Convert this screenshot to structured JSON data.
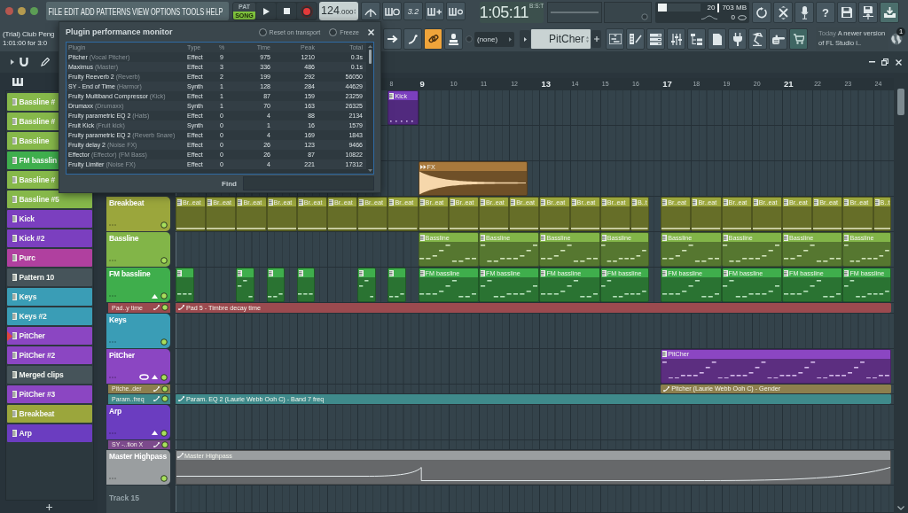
{
  "menu": [
    "FILE",
    "EDIT",
    "ADD",
    "PATTERNS",
    "VIEW",
    "OPTIONS",
    "TOOLS",
    "HELP"
  ],
  "transport": {
    "modes": [
      {
        "label": "PAT",
        "selected": false
      },
      {
        "label": "SONG",
        "selected": true
      }
    ],
    "tempo": "124",
    "tempo_fraction": ".000",
    "countdown_label": "3.2",
    "time": "1:05:11",
    "time_unit": "B:S:T"
  },
  "performance": {
    "cpu": {
      "level": 0.2
    },
    "cpu_reading": "20",
    "memory": "703 MB",
    "polyphony": "0"
  },
  "toolbar": {
    "help": "?"
  },
  "project": {
    "title": "(Trial) Club Peng",
    "length": "1:01:00 for 3:0"
  },
  "tools": [
    {
      "selected": false
    },
    {
      "selected": false
    },
    {
      "selected": true
    },
    {
      "selected": false
    }
  ],
  "dropdown": {
    "value": "(none)"
  },
  "pattern_selector": {
    "value": "PitCher"
  },
  "news": {
    "date": "Today",
    "text": "A newer version of FL Studio i..",
    "badge": "1"
  },
  "performance_monitor": {
    "title": "Plugin performance monitor",
    "options": [
      {
        "label": "Reset on transport",
        "checked": false
      },
      {
        "label": "Freeze",
        "checked": false
      }
    ],
    "columns": [
      "Plugin",
      "Type",
      "%",
      "Time",
      "Peak",
      "Total"
    ],
    "rows": [
      {
        "plugin": "Pitcher",
        "target": "(Vocal Pitcher)",
        "type": "Effect",
        "percent": "9",
        "time": "975",
        "peak": "1210",
        "total": "0.3s"
      },
      {
        "plugin": "Maximus",
        "target": "(Master)",
        "type": "Effect",
        "percent": "3",
        "time": "336",
        "peak": "486",
        "total": "0.1s"
      },
      {
        "plugin": "Fruity Reeverb 2",
        "target": "(Reverb)",
        "type": "Effect",
        "percent": "2",
        "time": "199",
        "peak": "292",
        "total": "56050"
      },
      {
        "plugin": "SY - End of Time",
        "target": "(Harmor)",
        "type": "Synth",
        "percent": "1",
        "time": "128",
        "peak": "284",
        "total": "44629"
      },
      {
        "plugin": "Fruity Multiband Compressor",
        "target": "(Kick)",
        "type": "Effect",
        "percent": "1",
        "time": "87",
        "peak": "159",
        "total": "23259"
      },
      {
        "plugin": "Drumaxx",
        "target": "(Drumaxx)",
        "type": "Synth",
        "percent": "1",
        "time": "70",
        "peak": "163",
        "total": "26325"
      },
      {
        "plugin": "Fruity parametric EQ 2",
        "target": "(Hats)",
        "type": "Effect",
        "percent": "0",
        "time": "4",
        "peak": "88",
        "total": "2134"
      },
      {
        "plugin": "Fruit Kick",
        "target": "(Fruit kick)",
        "type": "Synth",
        "percent": "0",
        "time": "1",
        "peak": "16",
        "total": "1579"
      },
      {
        "plugin": "Fruity parametric EQ 2",
        "target": "(Reverb Snare)",
        "type": "Effect",
        "percent": "0",
        "time": "4",
        "peak": "169",
        "total": "1843"
      },
      {
        "plugin": "Fruity delay 2",
        "target": "(Noise FX)",
        "type": "Effect",
        "percent": "0",
        "time": "26",
        "peak": "123",
        "total": "9466"
      },
      {
        "plugin": "Effector",
        "target": "(Effector) (FM Bass)",
        "type": "Effect",
        "percent": "0",
        "time": "26",
        "peak": "87",
        "total": "10822"
      },
      {
        "plugin": "Fruity Limiter",
        "target": "(Noise FX)",
        "type": "Effect",
        "percent": "0",
        "time": "4",
        "peak": "221",
        "total": "17312"
      }
    ],
    "find_label": "Find"
  },
  "patterns": [
    {
      "name": "Bassline #",
      "color": "#86b84a",
      "selected": false
    },
    {
      "name": "Bassline #",
      "color": "#86b84a",
      "selected": false
    },
    {
      "name": "Bassline",
      "color": "#86b84a",
      "selected": false
    },
    {
      "name": "FM basslin",
      "color": "#3fae4d",
      "selected": false
    },
    {
      "name": "Bassline #",
      "color": "#86b84a",
      "selected": false
    },
    {
      "name": "Bassline #5",
      "color": "#86b84a",
      "selected": false
    },
    {
      "name": "Kick",
      "color": "#7b3fbf",
      "selected": false
    },
    {
      "name": "Kick #2",
      "color": "#7b3fbf",
      "selected": false
    },
    {
      "name": "Purc",
      "color": "#b0409f",
      "selected": false
    },
    {
      "name": "Pattern 10",
      "color": "#46545a",
      "selected": false
    },
    {
      "name": "Keys",
      "color": "#3a9db6",
      "selected": false
    },
    {
      "name": "Keys #2",
      "color": "#3a9db6",
      "selected": false
    },
    {
      "name": "PitCher",
      "color": "#8b46c2",
      "selected": true
    },
    {
      "name": "PitCher #2",
      "color": "#8b46c2",
      "selected": false
    },
    {
      "name": "Merged clips",
      "color": "#46545a",
      "selected": false
    },
    {
      "name": "PitCher #3",
      "color": "#8b46c2",
      "selected": false
    },
    {
      "name": "Breakbeat",
      "color": "#9ba63c",
      "selected": false
    },
    {
      "name": "Arp",
      "color": "#6b3dc0",
      "selected": false
    }
  ],
  "playlist": {
    "ruler": [
      {
        "label": "8",
        "major": false
      },
      {
        "label": "9",
        "major": true
      },
      {
        "label": "10",
        "major": false
      },
      {
        "label": "11",
        "major": false
      },
      {
        "label": "12",
        "major": false
      },
      {
        "label": "13",
        "major": true
      },
      {
        "label": "14",
        "major": false
      },
      {
        "label": "15",
        "major": false
      },
      {
        "label": "16",
        "major": false
      },
      {
        "label": "17",
        "major": true
      },
      {
        "label": "18",
        "major": false
      },
      {
        "label": "19",
        "major": false
      },
      {
        "label": "20",
        "major": false
      },
      {
        "label": "21",
        "major": true
      },
      {
        "label": "22",
        "major": false
      },
      {
        "label": "23",
        "major": false
      },
      {
        "label": "24",
        "major": false
      }
    ],
    "tracks": [
      {
        "kind": "standard",
        "color": "#7b3fbf",
        "slots": [
          {
            "kind": "empty"
          },
          {
            "kind": "empty"
          },
          {
            "kind": "empty"
          },
          {
            "kind": "empty"
          },
          {
            "kind": "empty"
          },
          {
            "kind": "empty"
          },
          {
            "kind": "empty"
          },
          {
            "kind": "dots",
            "label": "Kick"
          }
        ]
      },
      {
        "kind": "standard"
      },
      {
        "kind": "standard",
        "color": "#a8793c",
        "slots": [
          {
            "kind": "empty"
          },
          {
            "kind": "empty"
          },
          {
            "kind": "empty"
          },
          {
            "kind": "empty"
          },
          {
            "kind": "empty"
          },
          {
            "kind": "empty"
          },
          {
            "kind": "empty"
          },
          {
            "kind": "empty"
          },
          {
            "kind": "audio",
            "label": "FX"
          },
          {
            "kind": "more"
          },
          {
            "kind": "more"
          },
          {
            "kind": "end"
          }
        ]
      },
      {
        "kind": "standard",
        "name": "Breakbeat",
        "color": "#9ba63c",
        "enabled": true,
        "slots": [
          {
            "kind": "line",
            "label": "Br..eat"
          },
          {
            "kind": "line",
            "label": "Br..eat"
          },
          {
            "kind": "line",
            "label": "Br..eat"
          },
          {
            "kind": "line",
            "label": "Br..eat"
          },
          {
            "kind": "line",
            "label": "Br..eat"
          },
          {
            "kind": "line",
            "label": "Br..eat"
          },
          {
            "kind": "line",
            "label": "Br..eat"
          },
          {
            "kind": "line",
            "label": "Br..eat"
          },
          {
            "kind": "line",
            "label": "Br..eat"
          },
          {
            "kind": "line",
            "label": "Br..eat"
          },
          {
            "kind": "line",
            "label": "Br..eat"
          },
          {
            "kind": "line",
            "label": "Br..eat"
          },
          {
            "kind": "line",
            "label": "Br..eat"
          },
          {
            "kind": "line",
            "label": "Br..eat"
          },
          {
            "kind": "line",
            "label": "Br..eat"
          },
          {
            "kind": "shortline",
            "label": "B..t"
          },
          {
            "kind": "line",
            "label": "Br..eat"
          },
          {
            "kind": "line",
            "label": "Br..eat"
          },
          {
            "kind": "line",
            "label": "Br..eat"
          },
          {
            "kind": "line",
            "label": "Br..eat"
          },
          {
            "kind": "line",
            "label": "Br..eat"
          },
          {
            "kind": "line",
            "label": "Br..eat"
          },
          {
            "kind": "line",
            "label": "Br..eat"
          },
          {
            "kind": "shortline",
            "label": "B..t"
          }
        ]
      },
      {
        "kind": "standard",
        "name": "Bassline",
        "color": "#82b548",
        "enabled": true,
        "slots": [
          {
            "kind": "empty"
          },
          {
            "kind": "empty"
          },
          {
            "kind": "empty"
          },
          {
            "kind": "empty"
          },
          {
            "kind": "empty"
          },
          {
            "kind": "empty"
          },
          {
            "kind": "empty"
          },
          {
            "kind": "empty"
          },
          {
            "kind": "notes",
            "label": "Bassline"
          },
          {
            "kind": "more"
          },
          {
            "kind": "notes",
            "label": "Bassline"
          },
          {
            "kind": "more"
          },
          {
            "kind": "notes",
            "label": "Bassline"
          },
          {
            "kind": "more"
          },
          {
            "kind": "notes",
            "label": "Bassline"
          },
          {
            "kind": "end"
          },
          {
            "kind": "notes",
            "label": "Bassline"
          },
          {
            "kind": "more"
          },
          {
            "kind": "notes",
            "label": "Bassline"
          },
          {
            "kind": "more"
          },
          {
            "kind": "notes",
            "label": "Bassline"
          },
          {
            "kind": "more"
          },
          {
            "kind": "notes",
            "label": "Bassline"
          },
          {
            "kind": "end"
          }
        ]
      },
      {
        "kind": "standard",
        "name": "FM bassline",
        "color": "#3fae4c",
        "enabled": true,
        "expanded": true,
        "slots": [
          {
            "kind": "shortnotes"
          },
          {
            "kind": "empty"
          },
          {
            "kind": "shortnotes"
          },
          {
            "kind": "shortnotes"
          },
          {
            "kind": "shortnotes"
          },
          {
            "kind": "empty"
          },
          {
            "kind": "shortnotes"
          },
          {
            "kind": "shortnotes"
          },
          {
            "kind": "notes",
            "label": "FM bassline"
          },
          {
            "kind": "more"
          },
          {
            "kind": "notes",
            "label": "FM bassline"
          },
          {
            "kind": "more"
          },
          {
            "kind": "notes",
            "label": "FM bassline"
          },
          {
            "kind": "more"
          },
          {
            "kind": "notes",
            "label": "FM bassline"
          },
          {
            "kind": "end"
          },
          {
            "kind": "notes",
            "label": "FM bassline"
          },
          {
            "kind": "more"
          },
          {
            "kind": "notes",
            "label": "FM bassline"
          },
          {
            "kind": "more"
          },
          {
            "kind": "notes",
            "label": "FM bassline"
          },
          {
            "kind": "more"
          },
          {
            "kind": "notes",
            "label": "FM bassline"
          },
          {
            "kind": "end"
          }
        ]
      },
      {
        "kind": "automation",
        "name": "Pad..y time",
        "color": "#9b4a4f",
        "enabled": true,
        "slots": [
          {
            "kind": "automation",
            "label": "Pad 5 - Timbre decay time"
          },
          {
            "kind": "more"
          },
          {
            "kind": "more"
          },
          {
            "kind": "more"
          },
          {
            "kind": "more"
          },
          {
            "kind": "more"
          },
          {
            "kind": "more"
          },
          {
            "kind": "more"
          },
          {
            "kind": "more"
          },
          {
            "kind": "more"
          },
          {
            "kind": "more"
          },
          {
            "kind": "more"
          },
          {
            "kind": "more"
          },
          {
            "kind": "more"
          },
          {
            "kind": "more"
          },
          {
            "kind": "more"
          },
          {
            "kind": "more"
          },
          {
            "kind": "more"
          },
          {
            "kind": "more"
          },
          {
            "kind": "more"
          },
          {
            "kind": "more"
          },
          {
            "kind": "more"
          },
          {
            "kind": "more"
          },
          {
            "kind": "end"
          }
        ]
      },
      {
        "kind": "standard",
        "name": "Keys",
        "color": "#3a9db6",
        "enabled": true
      },
      {
        "kind": "standard",
        "name": "PitCher",
        "color": "#8b46c2",
        "enabled": true,
        "expanded": true,
        "marked": true,
        "slots": [
          {
            "kind": "empty"
          },
          {
            "kind": "empty"
          },
          {
            "kind": "empty"
          },
          {
            "kind": "empty"
          },
          {
            "kind": "empty"
          },
          {
            "kind": "empty"
          },
          {
            "kind": "empty"
          },
          {
            "kind": "empty"
          },
          {
            "kind": "empty"
          },
          {
            "kind": "empty"
          },
          {
            "kind": "empty"
          },
          {
            "kind": "empty"
          },
          {
            "kind": "empty"
          },
          {
            "kind": "empty"
          },
          {
            "kind": "empty"
          },
          {
            "kind": "empty"
          },
          {
            "kind": "notes",
            "label": "PitCher"
          },
          {
            "kind": "more"
          },
          {
            "kind": "more"
          },
          {
            "kind": "more"
          },
          {
            "kind": "more"
          },
          {
            "kind": "more"
          },
          {
            "kind": "more"
          },
          {
            "kind": "end"
          }
        ]
      },
      {
        "kind": "automation",
        "name": "Pitche..der",
        "color": "#8d7f4e",
        "enabled": true,
        "slots": [
          {
            "kind": "empty"
          },
          {
            "kind": "empty"
          },
          {
            "kind": "empty"
          },
          {
            "kind": "empty"
          },
          {
            "kind": "empty"
          },
          {
            "kind": "empty"
          },
          {
            "kind": "empty"
          },
          {
            "kind": "empty"
          },
          {
            "kind": "empty"
          },
          {
            "kind": "empty"
          },
          {
            "kind": "empty"
          },
          {
            "kind": "empty"
          },
          {
            "kind": "empty"
          },
          {
            "kind": "empty"
          },
          {
            "kind": "empty"
          },
          {
            "kind": "empty"
          },
          {
            "kind": "automation",
            "label": "Pitcher (Laurie Webb Ooh C) - Gender"
          },
          {
            "kind": "more"
          },
          {
            "kind": "more"
          },
          {
            "kind": "more"
          },
          {
            "kind": "more"
          },
          {
            "kind": "more"
          },
          {
            "kind": "more"
          },
          {
            "kind": "end"
          }
        ]
      },
      {
        "kind": "automation",
        "name": "Param..freq",
        "color": "#3f8a8b",
        "enabled": true,
        "slots": [
          {
            "kind": "automation",
            "label": "Param. EQ 2 (Laurie Webb Ooh C) - Band 7 freq"
          },
          {
            "kind": "more"
          },
          {
            "kind": "more"
          },
          {
            "kind": "more"
          },
          {
            "kind": "more"
          },
          {
            "kind": "more"
          },
          {
            "kind": "more"
          },
          {
            "kind": "more"
          },
          {
            "kind": "more"
          },
          {
            "kind": "more"
          },
          {
            "kind": "more"
          },
          {
            "kind": "more"
          },
          {
            "kind": "more"
          },
          {
            "kind": "more"
          },
          {
            "kind": "more"
          },
          {
            "kind": "more"
          },
          {
            "kind": "more"
          },
          {
            "kind": "more"
          },
          {
            "kind": "more"
          },
          {
            "kind": "more"
          },
          {
            "kind": "more"
          },
          {
            "kind": "more"
          },
          {
            "kind": "more"
          },
          {
            "kind": "end"
          }
        ]
      },
      {
        "kind": "standard",
        "name": "Arp",
        "color": "#6b3dc0",
        "enabled": true,
        "expanded": true
      },
      {
        "kind": "automation",
        "name": "SY -..tion X",
        "color": "#7c4a8c",
        "enabled": true
      },
      {
        "kind": "standard",
        "name": "Master Highpass",
        "color": "#9a9ea0",
        "enabled": true,
        "slots": [
          {
            "kind": "automation",
            "label": "Master Highpass"
          },
          {
            "kind": "more"
          },
          {
            "kind": "more"
          },
          {
            "kind": "more"
          },
          {
            "kind": "more"
          },
          {
            "kind": "more"
          },
          {
            "kind": "more"
          },
          {
            "kind": "more"
          },
          {
            "kind": "more"
          },
          {
            "kind": "more"
          },
          {
            "kind": "more"
          },
          {
            "kind": "more"
          },
          {
            "kind": "more"
          },
          {
            "kind": "more"
          },
          {
            "kind": "more"
          },
          {
            "kind": "more"
          },
          {
            "kind": "more"
          },
          {
            "kind": "more"
          },
          {
            "kind": "more"
          },
          {
            "kind": "more"
          },
          {
            "kind": "more"
          },
          {
            "kind": "more"
          },
          {
            "kind": "more"
          },
          {
            "kind": "end"
          }
        ]
      },
      {
        "kind": "empty",
        "name": "Track 15"
      }
    ]
  }
}
